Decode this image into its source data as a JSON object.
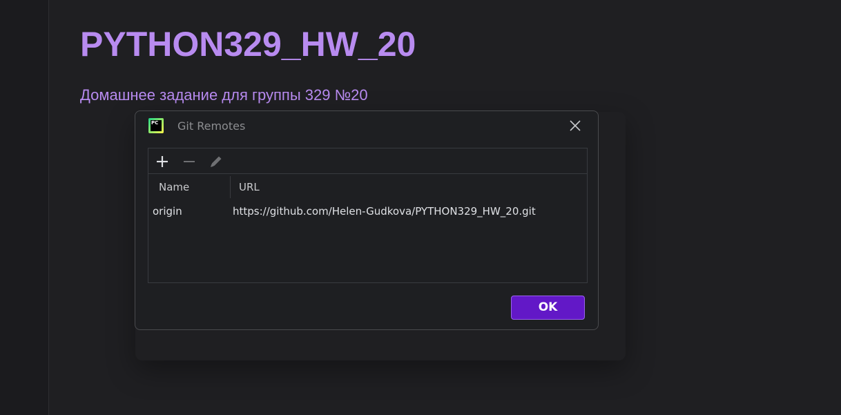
{
  "document": {
    "title": "PYTHON329_HW_20",
    "subtitle": "Домашнее задание для группы 329 №20"
  },
  "dialog": {
    "app_icon_text": "PC",
    "title": "Git Remotes",
    "toolbar": {
      "icons": [
        "add-icon",
        "remove-icon",
        "edit-icon"
      ]
    },
    "table": {
      "columns": [
        "Name",
        "URL"
      ],
      "rows": [
        {
          "name": "origin",
          "url": "https://github.com/Helen-Gudkova/PYTHON329_HW_20.git"
        }
      ]
    },
    "ok_label": "OK"
  },
  "colors": {
    "background": "#1f1f22",
    "heading": "#b88bf0",
    "accent_button": "#6218c7",
    "accent_border": "#9a63ee",
    "dialog_border": "#4a4b4e"
  }
}
